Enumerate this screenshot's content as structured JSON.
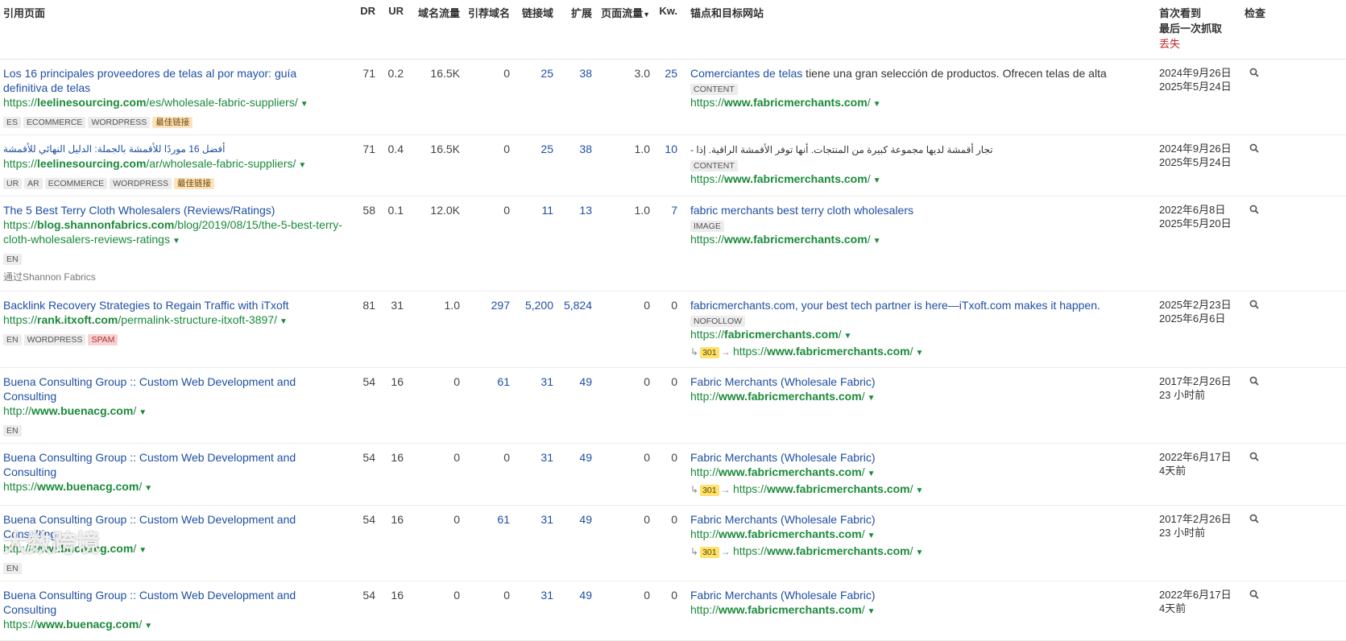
{
  "headers": {
    "ref_page": "引用页面",
    "dr": "DR",
    "ur": "UR",
    "domain_traffic": "域名流量",
    "ref_domains": "引荐域名",
    "linked_domains": "链接域",
    "ext": "扩展",
    "page_traffic": "页面流量",
    "kw": "Kw.",
    "anchor_target": "锚点和目标网站",
    "first_seen": "首次看到",
    "last_crawl": "最后一次抓取",
    "lost": "丢失",
    "inspect": "检查"
  },
  "rows": [
    {
      "title": "Los 16 principales proveedores de telas al por mayor: guía definitiva de telas",
      "url_pre": "https://",
      "url_domain": "leelinesourcing.com",
      "url_path": "/es/wholesale-fabric-suppliers/",
      "tags": [
        "ES",
        "ECOMMERCE",
        "WORDPRESS",
        "最佳链接"
      ],
      "via": "",
      "dr": "71",
      "ur": "0.2",
      "domain_traffic": "16.5K",
      "ref_domains": "0",
      "linked_domains": "25",
      "ext": "38",
      "page_traffic": "3.0",
      "kw": "25",
      "anchor_link": "Comerciantes de telas",
      "anchor_rest": " tiene una gran selección de productos. Ofrecen telas de alta",
      "anchor_tag": "CONTENT",
      "target_pre": "https://",
      "target_domain": "www.fabricmerchants.com",
      "target_path": "/",
      "redirect": null,
      "first_seen": "2024年9月26日",
      "last_crawl": "2025年5月24日"
    },
    {
      "title": "أفضل 16 موردًا للأقمشة بالجملة: الدليل النهائي للأقمشة",
      "url_pre": "https://",
      "url_domain": "leelinesourcing.com",
      "url_path": "/ar/wholesale-fabric-suppliers/",
      "tags": [
        "UR",
        "AR",
        "ECOMMERCE",
        "WORDPRESS",
        "最佳链接"
      ],
      "via": "",
      "dr": "71",
      "ur": "0.4",
      "domain_traffic": "16.5K",
      "ref_domains": "0",
      "linked_domains": "25",
      "ext": "38",
      "page_traffic": "1.0",
      "kw": "10",
      "anchor_link": "",
      "anchor_rest": "تجار أقمشة لديها مجموعة كبيرة من المنتجات. أنها توفر الأقمشة الراقية. إذا -",
      "anchor_tag": "CONTENT",
      "target_pre": "https://",
      "target_domain": "www.fabricmerchants.com",
      "target_path": "/",
      "redirect": null,
      "first_seen": "2024年9月26日",
      "last_crawl": "2025年5月24日"
    },
    {
      "title": "The 5 Best Terry Cloth Wholesalers (Reviews/Ratings)",
      "url_pre": "https://",
      "url_domain": "blog.shannonfabrics.com",
      "url_path": "/blog/2019/08/15/the-5-best-terry-cloth-wholesalers-reviews-ratings",
      "tags": [
        "EN"
      ],
      "via": "通过Shannon Fabrics",
      "dr": "58",
      "ur": "0.1",
      "domain_traffic": "12.0K",
      "ref_domains": "0",
      "linked_domains": "11",
      "ext": "13",
      "page_traffic": "1.0",
      "kw": "7",
      "anchor_link": "fabric merchants best terry cloth wholesalers",
      "anchor_rest": "",
      "anchor_tag": "IMAGE",
      "target_pre": "https://",
      "target_domain": "www.fabricmerchants.com",
      "target_path": "/",
      "redirect": null,
      "first_seen": "2022年6月8日",
      "last_crawl": "2025年5月20日"
    },
    {
      "title": "Backlink Recovery Strategies to Regain Traffic with iTxoft",
      "url_pre": "https://",
      "url_domain": "rank.itxoft.com",
      "url_path": "/permalink-structure-itxoft-3897/",
      "tags": [
        "EN",
        "WORDPRESS",
        "SPAM"
      ],
      "via": "",
      "dr": "81",
      "ur": "31",
      "domain_traffic": "1.0",
      "ref_domains": "297",
      "linked_domains": "5,200",
      "ext": "5,824",
      "page_traffic": "0",
      "kw": "0",
      "anchor_link": "fabricmerchants.com, your best tech partner is here—iTxoft.com makes it happen.",
      "anchor_rest": "",
      "anchor_tag": "NOFOLLOW",
      "target_pre": "https://",
      "target_domain": "fabricmerchants.com",
      "target_path": "/",
      "redirect": {
        "code": "301",
        "pre": "https://",
        "domain": "www.fabricmerchants.com",
        "path": "/"
      },
      "first_seen": "2025年2月23日",
      "last_crawl": "2025年6月6日"
    },
    {
      "title": "Buena Consulting Group :: Custom Web Development and Consulting",
      "url_pre": "http://",
      "url_domain": "www.buenacg.com",
      "url_path": "/",
      "tags": [
        "EN"
      ],
      "via": "",
      "dr": "54",
      "ur": "16",
      "domain_traffic": "0",
      "ref_domains": "61",
      "linked_domains": "31",
      "ext": "49",
      "page_traffic": "0",
      "kw": "0",
      "anchor_link": "Fabric Merchants (Wholesale Fabric)",
      "anchor_rest": "",
      "anchor_tag": "",
      "target_pre": "http://",
      "target_domain": "www.fabricmerchants.com",
      "target_path": "/",
      "redirect": null,
      "first_seen": "2017年2月26日",
      "last_crawl": "23 小时前"
    },
    {
      "title": "Buena Consulting Group :: Custom Web Development and Consulting",
      "url_pre": "https://",
      "url_domain": "www.buenacg.com",
      "url_path": "/",
      "tags": [],
      "via": "",
      "dr": "54",
      "ur": "16",
      "domain_traffic": "0",
      "ref_domains": "0",
      "linked_domains": "31",
      "ext": "49",
      "page_traffic": "0",
      "kw": "0",
      "anchor_link": "Fabric Merchants (Wholesale Fabric)",
      "anchor_rest": "",
      "anchor_tag": "",
      "target_pre": "http://",
      "target_domain": "www.fabricmerchants.com",
      "target_path": "/",
      "redirect": {
        "code": "301",
        "pre": "https://",
        "domain": "www.fabricmerchants.com",
        "path": "/"
      },
      "first_seen": "2022年6月17日",
      "last_crawl": "4天前"
    },
    {
      "title": "Buena Consulting Group :: Custom Web Development and Consulting",
      "url_pre": "http://",
      "url_domain": "www.buenacg.com",
      "url_path": "/",
      "tags": [
        "EN"
      ],
      "via": "",
      "dr": "54",
      "ur": "16",
      "domain_traffic": "0",
      "ref_domains": "61",
      "linked_domains": "31",
      "ext": "49",
      "page_traffic": "0",
      "kw": "0",
      "anchor_link": "Fabric Merchants (Wholesale Fabric)",
      "anchor_rest": "",
      "anchor_tag": "",
      "target_pre": "http://",
      "target_domain": "www.fabricmerchants.com",
      "target_path": "/",
      "redirect": {
        "code": "301",
        "pre": "https://",
        "domain": "www.fabricmerchants.com",
        "path": "/"
      },
      "first_seen": "2017年2月26日",
      "last_crawl": "23 小时前"
    },
    {
      "title": "Buena Consulting Group :: Custom Web Development and Consulting",
      "url_pre": "https://",
      "url_domain": "www.buenacg.com",
      "url_path": "/",
      "tags": [],
      "via": "",
      "dr": "54",
      "ur": "16",
      "domain_traffic": "0",
      "ref_domains": "0",
      "linked_domains": "31",
      "ext": "49",
      "page_traffic": "0",
      "kw": "0",
      "anchor_link": "Fabric Merchants (Wholesale Fabric)",
      "anchor_rest": "",
      "anchor_tag": "",
      "target_pre": "http://",
      "target_domain": "www.fabricmerchants.com",
      "target_path": "/",
      "redirect": null,
      "first_seen": "2022年6月17日",
      "last_crawl": "4天前"
    }
  ],
  "watermark": "大数跨境",
  "icons": {
    "inspect": "magnifier-icon",
    "dropdown": "caret-down-icon",
    "sort": "sort-desc-icon",
    "redirect": "redirect-arrow-icon"
  }
}
